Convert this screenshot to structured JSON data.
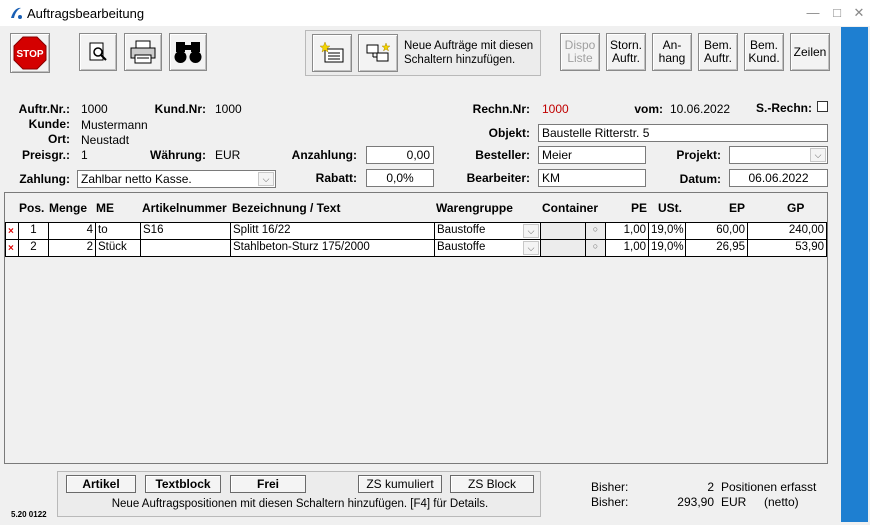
{
  "window": {
    "title": "Auftragsbearbeitung",
    "min": "—",
    "max": "□",
    "close": "✕"
  },
  "toolbar": {
    "hint": "Neue Aufträge mit diesen Schaltern hinzufügen.",
    "dispo": "Dispo Liste",
    "storn": "Storn. Auftr.",
    "anhang": "An- hang",
    "bem_auftr": "Bem. Auftr.",
    "bem_kund": "Bem. Kund.",
    "zeilen": "Zeilen"
  },
  "header": {
    "auftr_nr_label": "Auftr.Nr.:",
    "auftr_nr": "1000",
    "kund_nr_label": "Kund.Nr:",
    "kund_nr": "1000",
    "kunde_label": "Kunde:",
    "kunde": "Mustermann",
    "ort_label": "Ort:",
    "ort": "Neustadt",
    "preisgr_label": "Preisgr.:",
    "preisgr": "1",
    "waehrung_label": "Währung:",
    "waehrung": "EUR",
    "anzahlung_label": "Anzahlung:",
    "anzahlung": "0,00",
    "zahlung_label": "Zahlung:",
    "zahlung": "Zahlbar netto Kasse.",
    "rabatt_label": "Rabatt:",
    "rabatt": "0,0%",
    "rechn_nr_label": "Rechn.Nr:",
    "rechn_nr": "1000",
    "vom_label": "vom:",
    "vom": "10.06.2022",
    "s_rechn_label": "S.-Rechn:",
    "objekt_label": "Objekt:",
    "objekt": "Baustelle Ritterstr. 5",
    "besteller_label": "Besteller:",
    "besteller": "Meier",
    "projekt_label": "Projekt:",
    "projekt": "",
    "bearbeiter_label": "Bearbeiter:",
    "bearbeiter": "KM",
    "datum_label": "Datum:",
    "datum": "06.06.2022"
  },
  "grid": {
    "columns": [
      "Pos.",
      "Menge",
      "ME",
      "Artikelnummer",
      "Bezeichnung / Text",
      "Warengruppe",
      "Container",
      "PE",
      "USt.",
      "EP",
      "GP"
    ],
    "rows": [
      {
        "pos": "1",
        "menge": "4",
        "me": "to",
        "artnr": "S16",
        "bez": "Splitt 16/22",
        "wg": "Baustoffe",
        "pe": "1,00",
        "ust": "19,0%",
        "ep": "60,00",
        "gp": "240,00"
      },
      {
        "pos": "2",
        "menge": "2",
        "me": "Stück",
        "artnr": "",
        "bez": "Stahlbeton-Sturz 175/2000",
        "wg": "Baustoffe",
        "pe": "1,00",
        "ust": "19,0%",
        "ep": "26,95",
        "gp": "53,90"
      }
    ]
  },
  "bottom": {
    "artikel": "Artikel",
    "textblock": "Textblock",
    "frei": "Frei",
    "zs_kumuliert": "ZS kumuliert",
    "zs_block": "ZS Block",
    "hint": "Neue Auftragspositionen mit diesen Schaltern hinzufügen. [F4] für Details.",
    "version": "5.20 0122",
    "bisher_label": "Bisher:",
    "count": "2",
    "count_text": "Positionen erfasst",
    "sum": "293,90",
    "currency": "EUR",
    "netto": "(netto)"
  }
}
